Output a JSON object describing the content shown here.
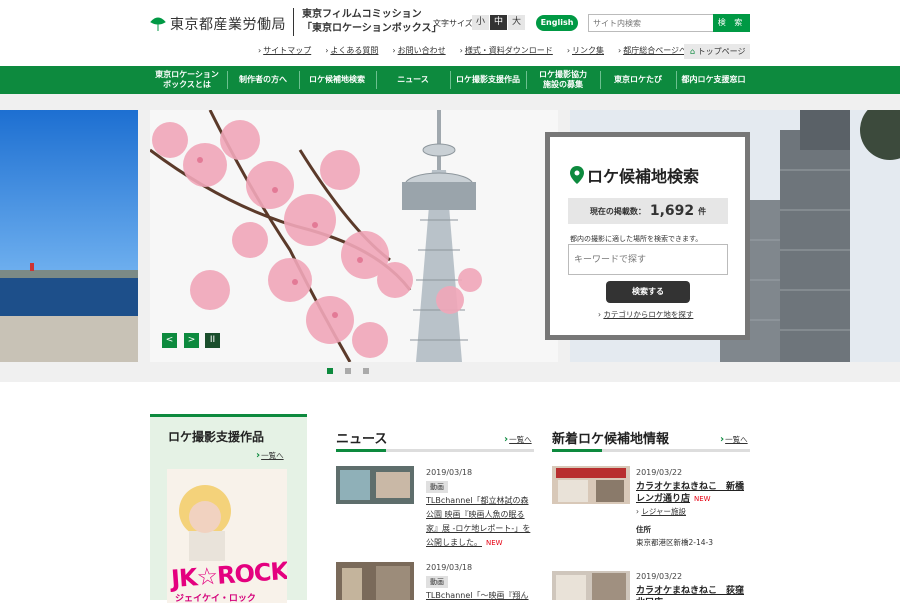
{
  "header": {
    "org_name": "東京都産業労働局",
    "site_name_line1": "東京フィルムコミッション",
    "site_name_line2": "「東京ロケーションボックス」",
    "font_size_label": "文字サイズ",
    "font_sizes": [
      "小",
      "中",
      "大"
    ],
    "english_label": "English",
    "search_placeholder": "サイト内検索",
    "search_button": "検 索",
    "util_links": [
      "サイトマップ",
      "よくある質問",
      "お問い合わせ",
      "様式・資料ダウンロード",
      "リンク集",
      "都庁総合ページへのリンク"
    ],
    "top_page_label": "トップページ"
  },
  "nav": {
    "items": [
      "東京ロケーション\nボックスとは",
      "制作者の方へ",
      "ロケ候補地検索",
      "ニュース",
      "ロケ撮影支援作品",
      "ロケ撮影協力\n施設の募集",
      "東京ロケたび",
      "都内ロケ支援窓口"
    ]
  },
  "hero": {
    "prev_label": "<",
    "next_label": ">",
    "pause_label": "II",
    "active_slide": 1,
    "slide_count": 3
  },
  "location_search": {
    "title": "ロケ候補地検索",
    "count_label": "現在の掲載数：",
    "count_value": "1,692",
    "count_unit": "件",
    "description": "都内の撮影に適した場所を検索できます。",
    "input_placeholder": "キーワードで探す",
    "submit_label": "検索する",
    "category_link": "カテゴリからロケ地を探す"
  },
  "works": {
    "title": "ロケ撮影支援作品",
    "more_label": "一覧へ",
    "poster_text": "JK☆ROCK",
    "poster_sub": "ジェイケイ・ロック"
  },
  "news": {
    "title": "ニュース",
    "more_label": "一覧へ",
    "items": [
      {
        "date": "2019/03/18",
        "tag": "動画",
        "text": "TLBchannel「都立林試の森公園 映画『映画人魚の眠る家』展 -ロケ地レポート-」を公開しました。",
        "new": "NEW"
      },
      {
        "date": "2019/03/18",
        "tag": "動画",
        "text": "TLBchannel「～映画『翔ん"
      }
    ]
  },
  "locations": {
    "title": "新着ロケ候補地情報",
    "more_label": "一覧へ",
    "items": [
      {
        "date": "2019/03/22",
        "name": "カラオケまねきねこ　新橋レンガ通り店",
        "new": "NEW",
        "category": "レジャー施設",
        "address_label": "住所",
        "address": "東京都港区新橋2-14-3"
      },
      {
        "date": "2019/03/22",
        "name": "カラオケまねきねこ　荻窪北口店"
      }
    ]
  },
  "colors": {
    "brand_green": "#0d8a3e",
    "new_red": "#e60012"
  }
}
